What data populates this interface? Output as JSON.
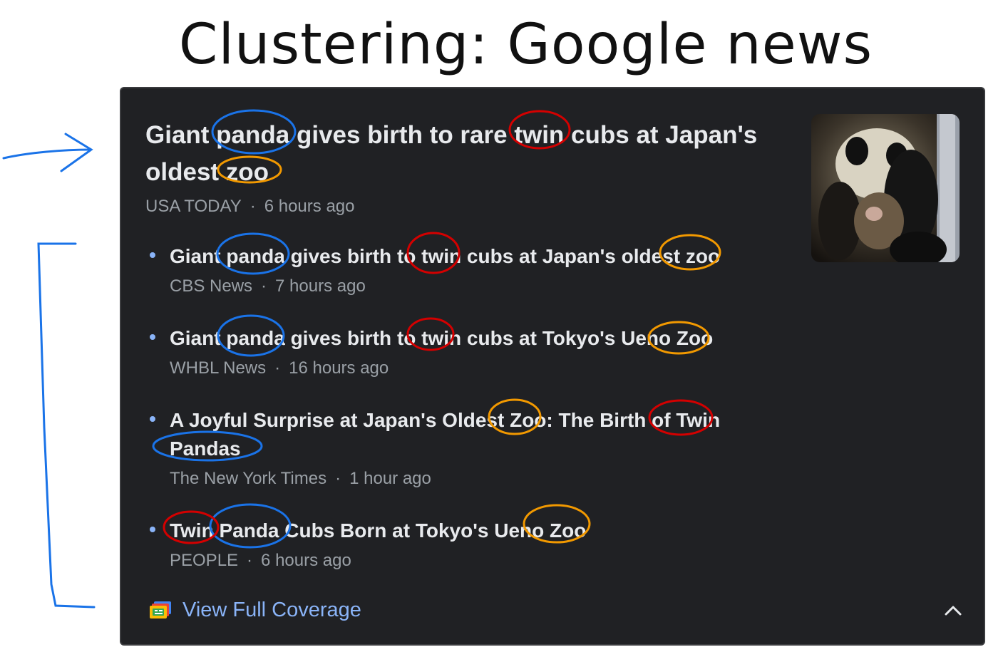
{
  "slide": {
    "title": "Clustering: Google news"
  },
  "card": {
    "headline": "Giant panda gives birth to rare twin cubs at Japan's oldest zoo",
    "source": "USA TODAY",
    "time": "6 hours ago",
    "thumbnail_icon": "panda-photo",
    "items": [
      {
        "title": "Giant panda gives birth to twin cubs at Japan's oldest zoo",
        "source": "CBS News",
        "time": "7 hours ago"
      },
      {
        "title": "Giant panda gives birth to twin cubs at Tokyo's Ueno Zoo",
        "source": "WHBL News",
        "time": "16 hours ago"
      },
      {
        "title": "A Joyful Surprise at Japan's Oldest Zoo: The Birth of Twin Pandas",
        "source": "The New York Times",
        "time": "1 hour ago"
      },
      {
        "title": "Twin Panda Cubs Born at Tokyo's Ueno Zoo",
        "source": "PEOPLE",
        "time": "6 hours ago"
      }
    ],
    "coverage_label": "View Full Coverage",
    "coverage_icon": "full-coverage-icon",
    "collapse_icon": "chevron-up-icon"
  },
  "colors": {
    "card_bg": "#202124",
    "link": "#8ab4f8",
    "annotation_blue": "#1a73e8",
    "annotation_red": "#d40000",
    "annotation_orange": "#f29900"
  }
}
